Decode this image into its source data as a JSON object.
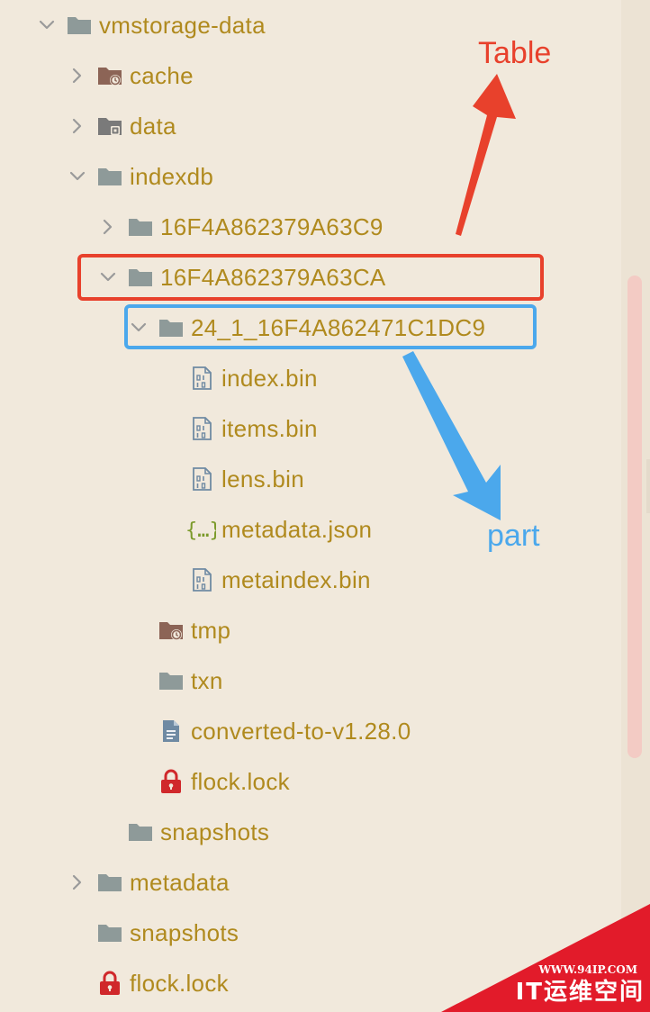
{
  "colors": {
    "background": "#f1e9dc",
    "label": "#b08a1e",
    "folder": "#8e9a99",
    "folder_special": "#8c6456",
    "chevron": "#9a9a9a",
    "lock": "#d0282b",
    "json": "#7b9a2a",
    "bin_icon": "#6f8aa3",
    "table_annotation": "#e8412c",
    "part_annotation": "#4ba8ec",
    "scroll_thumb": "#f3cbc4",
    "watermark_red": "#e21b2a"
  },
  "tree": [
    {
      "depth": 0,
      "chevron": "down",
      "icon": "folder-icon",
      "label": "vmstorage-data"
    },
    {
      "depth": 1,
      "chevron": "right",
      "icon": "cache-folder-icon",
      "label": "cache"
    },
    {
      "depth": 1,
      "chevron": "right",
      "icon": "data-folder-icon",
      "label": "data"
    },
    {
      "depth": 1,
      "chevron": "down",
      "icon": "folder-icon",
      "label": "indexdb"
    },
    {
      "depth": 2,
      "chevron": "right",
      "icon": "folder-icon",
      "label": "16F4A862379A63C9"
    },
    {
      "depth": 2,
      "chevron": "down",
      "icon": "folder-icon",
      "label": "16F4A862379A63CA",
      "highlight": "table"
    },
    {
      "depth": 3,
      "chevron": "down",
      "icon": "folder-icon",
      "label": "24_1_16F4A862471C1DC9",
      "highlight": "part"
    },
    {
      "depth": 4,
      "chevron": "",
      "icon": "binary-file-icon",
      "label": "index.bin"
    },
    {
      "depth": 4,
      "chevron": "",
      "icon": "binary-file-icon",
      "label": "items.bin"
    },
    {
      "depth": 4,
      "chevron": "",
      "icon": "binary-file-icon",
      "label": "lens.bin"
    },
    {
      "depth": 4,
      "chevron": "",
      "icon": "json-file-icon",
      "label": "metadata.json"
    },
    {
      "depth": 4,
      "chevron": "",
      "icon": "binary-file-icon",
      "label": "metaindex.bin"
    },
    {
      "depth": 3,
      "chevron": "",
      "icon": "tmp-folder-icon",
      "label": "tmp"
    },
    {
      "depth": 3,
      "chevron": "",
      "icon": "folder-icon",
      "label": "txn"
    },
    {
      "depth": 3,
      "chevron": "",
      "icon": "text-file-icon",
      "label": "converted-to-v1.28.0"
    },
    {
      "depth": 3,
      "chevron": "",
      "icon": "lock-icon",
      "label": "flock.lock"
    },
    {
      "depth": 2,
      "chevron": "",
      "icon": "folder-icon",
      "label": "snapshots"
    },
    {
      "depth": 1,
      "chevron": "right",
      "icon": "folder-icon",
      "label": "metadata"
    },
    {
      "depth": 1,
      "chevron": "",
      "icon": "folder-icon",
      "label": "snapshots"
    },
    {
      "depth": 1,
      "chevron": "",
      "icon": "lock-icon",
      "label": "flock.lock"
    }
  ],
  "annotations": {
    "table_label": "Table",
    "part_label": "part"
  },
  "watermark": {
    "url": "WWW.94IP.COM",
    "text": "IT运维空间"
  }
}
